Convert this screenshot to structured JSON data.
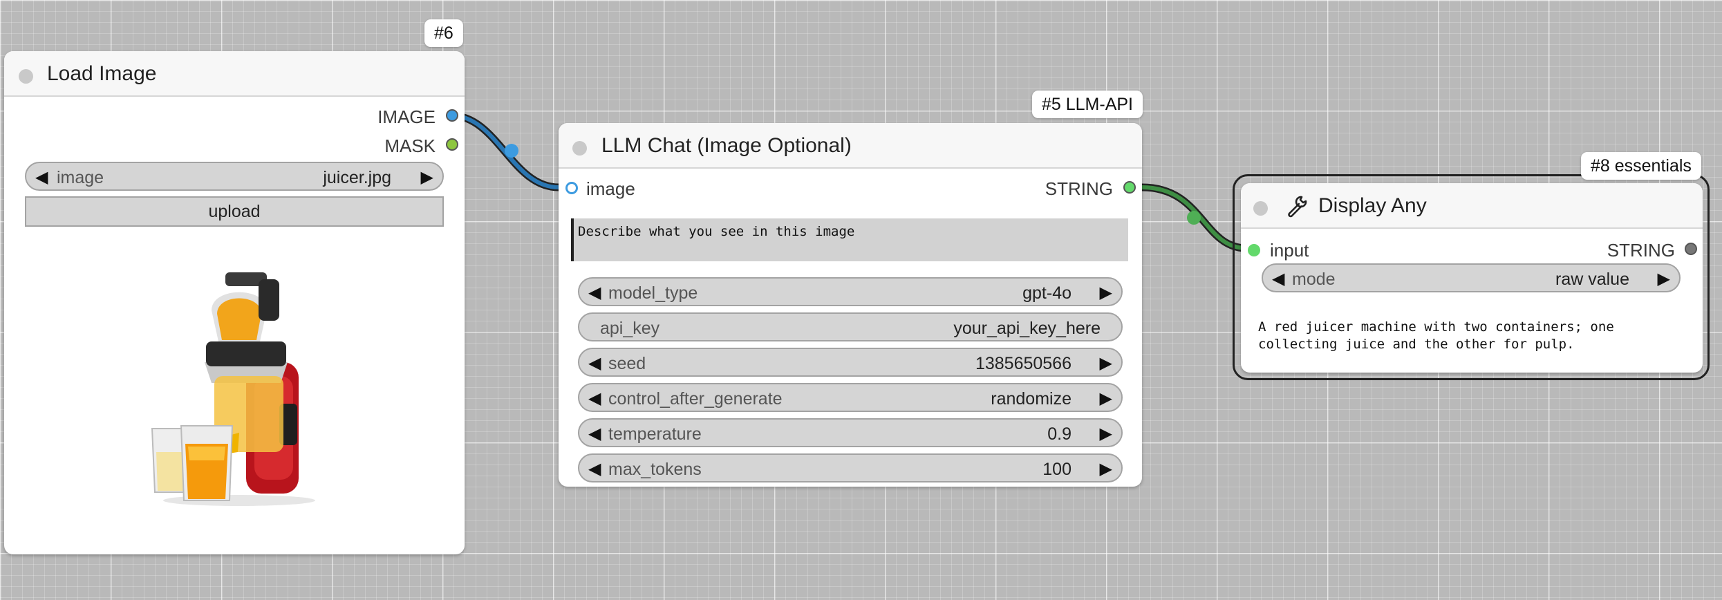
{
  "colors": {
    "image_type": "#3d9be0",
    "mask_type": "#8dc63f",
    "string_type": "#63d96b",
    "link_image": "#2a76b2",
    "link_string": "#3e8e44",
    "canvas": "#b9b9b9"
  },
  "nodes": {
    "load_image": {
      "badge": "#6",
      "title": "Load Image",
      "outputs": [
        "IMAGE",
        "MASK"
      ],
      "widget_image": {
        "name": "image",
        "value": "juicer.jpg"
      },
      "upload_label": "upload",
      "preview_alt": "juicer image preview"
    },
    "llm_chat": {
      "badge": "#5 LLM-API",
      "title": "LLM Chat (Image Optional)",
      "input": "image",
      "output": "STRING",
      "prompt": "Describe what you see in this image",
      "widgets": [
        {
          "name": "model_type",
          "value": "gpt-4o"
        },
        {
          "name": "api_key",
          "value": "your_api_key_here"
        },
        {
          "name": "seed",
          "value": "1385650566"
        },
        {
          "name": "control_after_generate",
          "value": "randomize"
        },
        {
          "name": "temperature",
          "value": "0.9"
        },
        {
          "name": "max_tokens",
          "value": "100"
        }
      ]
    },
    "display_any": {
      "badge": "#8 essentials",
      "title": "Display Any",
      "icon": "wrench-icon",
      "input": "input",
      "output": "STRING",
      "widget_mode": {
        "name": "mode",
        "value": "raw value"
      },
      "output_text_line1": "A red juicer machine with two containers; one",
      "output_text_line2": "collecting juice and the other for pulp."
    }
  }
}
